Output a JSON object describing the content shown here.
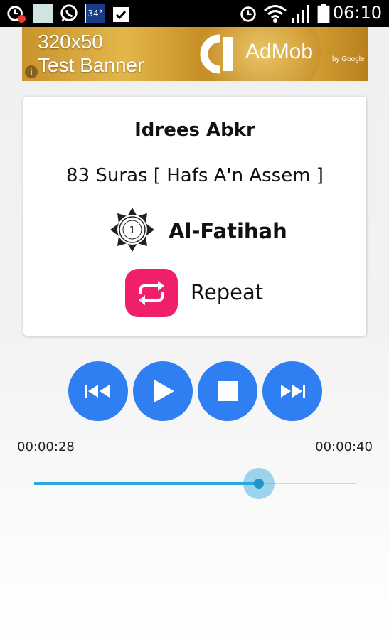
{
  "status_bar": {
    "time": "06:10",
    "temperature": "34°",
    "icons": [
      "alarm-notification-icon",
      "gallery-icon",
      "whatsapp-icon",
      "weather-icon",
      "clipboard-check-icon",
      "alarm-icon",
      "wifi-icon",
      "signal-icon",
      "battery-icon"
    ]
  },
  "ad": {
    "line1": "320x50",
    "line2": "Test Banner",
    "brand": "AdMob",
    "by": "by Google",
    "info": "i"
  },
  "player": {
    "reciter": "Idrees Abkr",
    "riwaya": "83 Suras [ Hafs A'n Assem ]",
    "surah_number": "1",
    "surah_name": "Al-Fatihah",
    "repeat_label": "Repeat",
    "repeat_color": "#f01f6a"
  },
  "controls": {
    "accent": "#2f7ff2",
    "buttons": [
      "previous-icon",
      "play-icon",
      "stop-icon",
      "next-icon"
    ]
  },
  "progress": {
    "elapsed": "00:00:28",
    "total": "00:00:40",
    "fraction": 0.7,
    "color": "#2aa7dd"
  }
}
